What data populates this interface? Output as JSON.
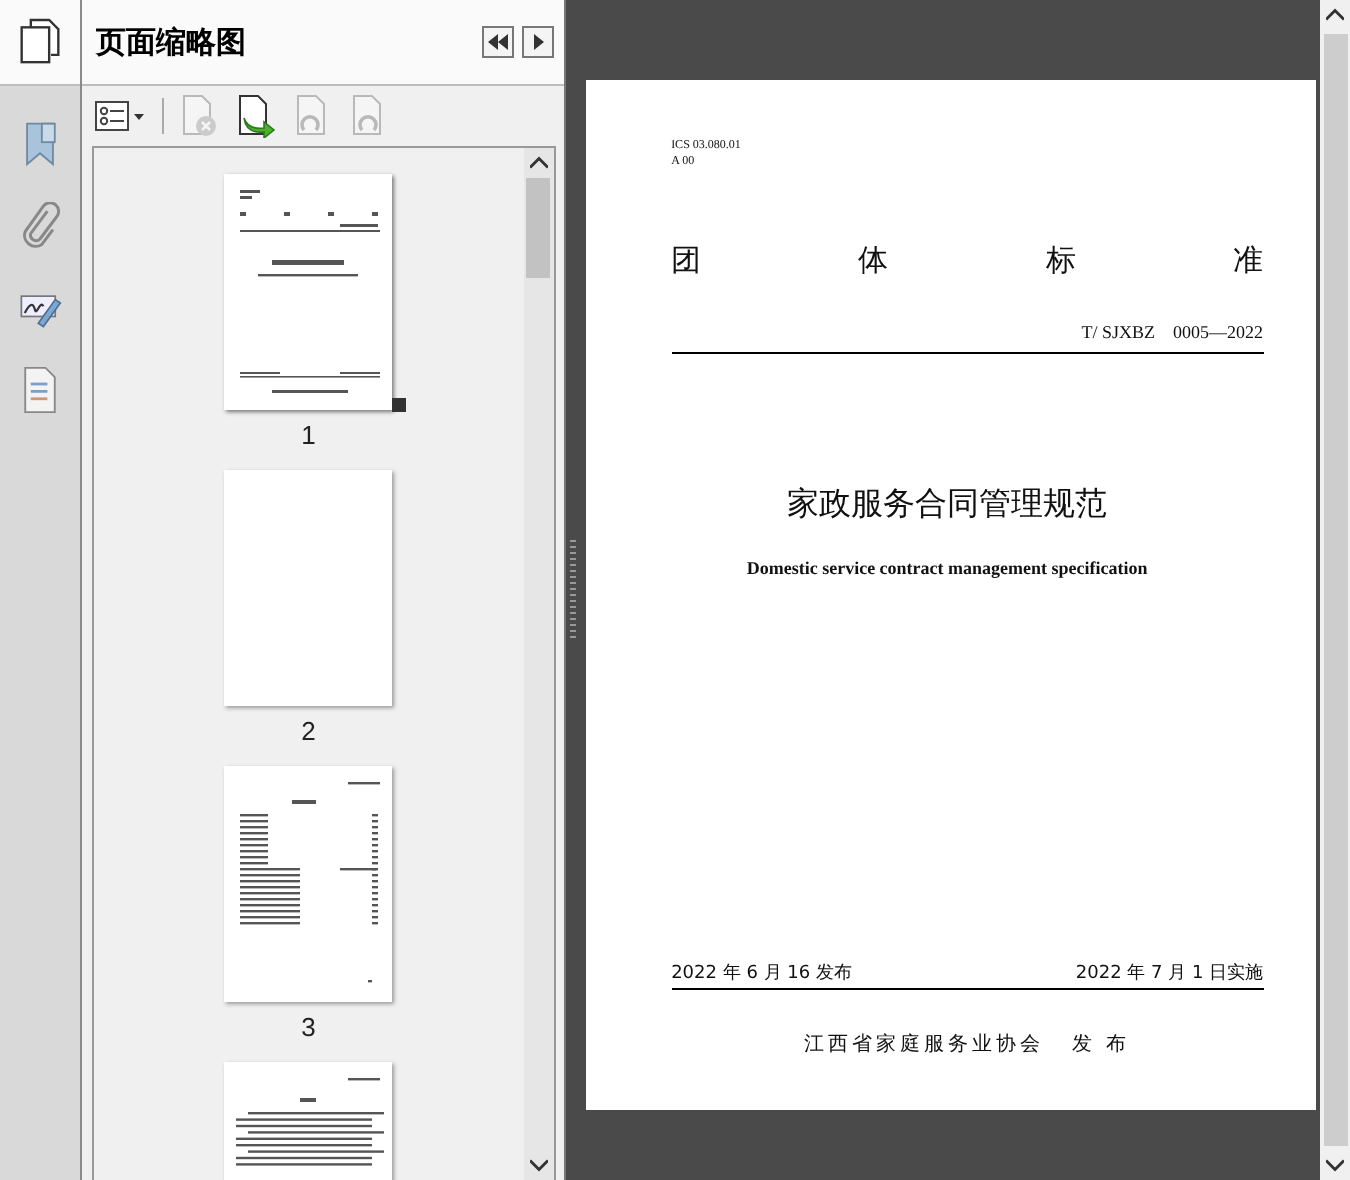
{
  "panel": {
    "title": "页面缩略图"
  },
  "toolbar": [
    {
      "kind": "options",
      "disabled": false
    },
    {
      "kind": "delete",
      "disabled": true
    },
    {
      "kind": "insert",
      "disabled": false
    },
    {
      "kind": "rotate-left",
      "disabled": true
    },
    {
      "kind": "rotate-right",
      "disabled": true
    }
  ],
  "thumbnails": [
    {
      "kind": "cover",
      "label": "1",
      "current": true
    },
    {
      "kind": "blank",
      "label": "2",
      "current": false
    },
    {
      "kind": "contents",
      "label": "3",
      "current": false
    },
    {
      "kind": "text",
      "current": false
    }
  ],
  "document": {
    "ics": "ICS  03.080.01",
    "class": "A 00",
    "heading": [
      "团",
      "体",
      "标",
      "准"
    ],
    "code": "T/ SJXBZ　0005—2022",
    "title": "家政服务合同管理规范",
    "subtitle": "Domestic service contract management specification",
    "release": "2022  年 6 月 16 发布",
    "effective": "2022 年 7 月 1 日实施",
    "publisher": "江西省家庭服务业协会",
    "publish": "发 布"
  }
}
